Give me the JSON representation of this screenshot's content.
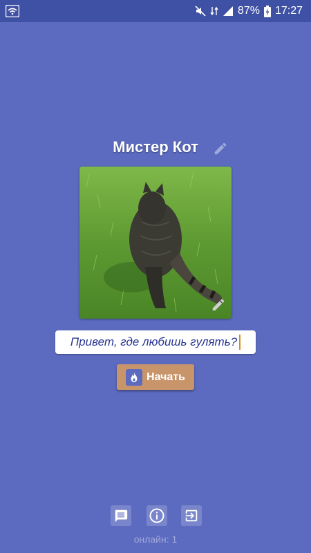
{
  "status_bar": {
    "battery": "87%",
    "time": "17:27"
  },
  "profile": {
    "name": "Мистер Кот"
  },
  "message_input": {
    "value": "Привет, где любишь гулять?"
  },
  "start_button": {
    "label": "Начать"
  },
  "footer": {
    "online_text": "онлайн: 1"
  },
  "colors": {
    "background": "#5c6bc0",
    "status_bar": "#3f51a5",
    "start_button": "#c8956b",
    "input_text": "#283593",
    "caret": "#d98b1f"
  }
}
